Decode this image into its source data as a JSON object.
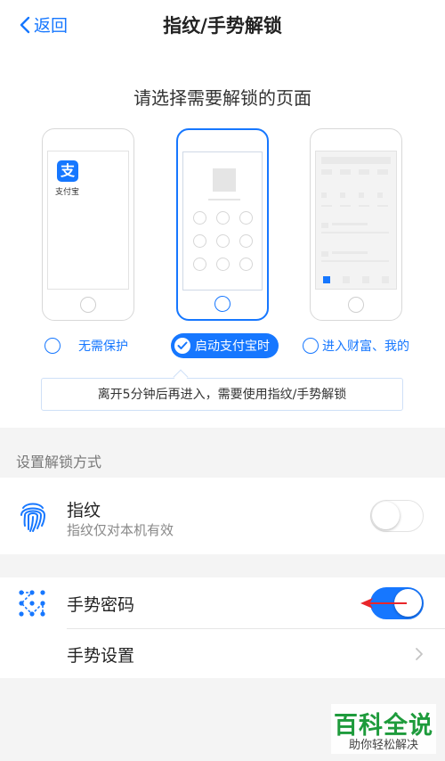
{
  "nav": {
    "back_label": "返回",
    "title": "指纹/手势解锁"
  },
  "choose": {
    "title": "请选择需要解锁的页面",
    "app_name": "支付宝",
    "options": [
      {
        "label": "无需保护",
        "selected": false
      },
      {
        "label": "启动支付宝时",
        "selected": true
      },
      {
        "label": "进入财富、我的",
        "selected": false
      }
    ],
    "tip": "离开5分钟后再进入，需要使用指纹/手势解锁"
  },
  "unlock": {
    "group_header": "设置解锁方式",
    "fingerprint": {
      "title": "指纹",
      "subtitle": "指纹仅对本机有效",
      "enabled": false,
      "icon": "fingerprint-icon"
    },
    "gesture": {
      "title": "手势密码",
      "enabled": true,
      "icon": "gesture-dots-icon"
    },
    "gesture_settings": {
      "title": "手势设置",
      "icon": "chevron-right-icon"
    }
  },
  "watermark": {
    "title": "百科全说",
    "subtitle": "助你轻松解决"
  },
  "colors": {
    "accent": "#1677ff",
    "watermark_green": "#1e9b3c",
    "arrow_red": "#e8262a"
  }
}
